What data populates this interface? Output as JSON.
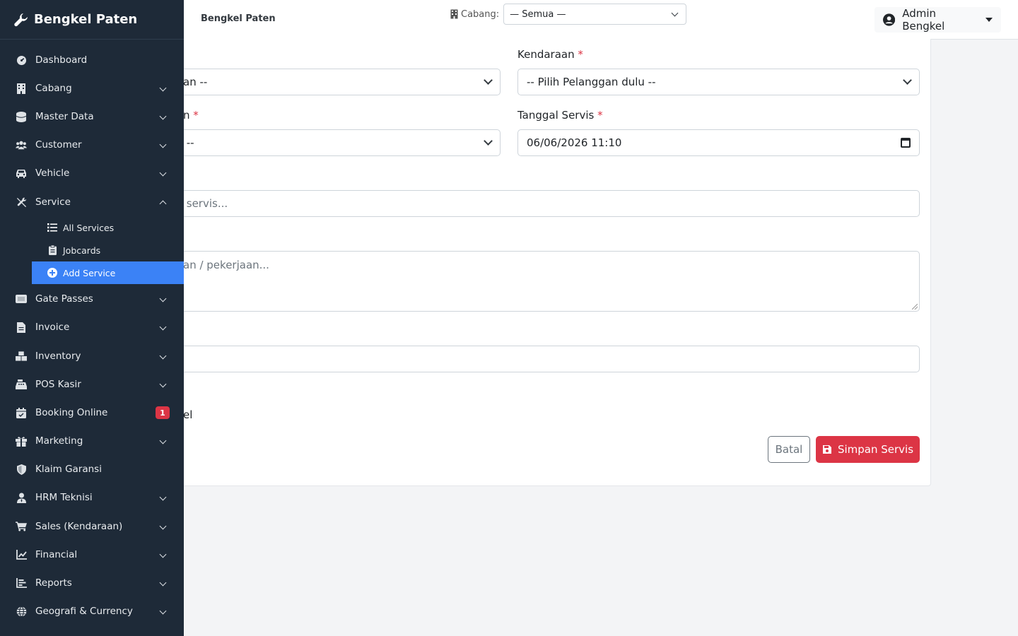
{
  "topbar": {
    "brand": "Bengkel Paten",
    "branch_label": "Cabang:",
    "branch_value": "— Semua —",
    "user_name": "Admin Bengkel"
  },
  "form": {
    "customer_select": "an --",
    "vehicle_label": "Kendaraan",
    "vehicle_select": "-- Pilih Pelanggan dulu --",
    "type_label_partial": "n",
    "type_select": " --",
    "date_label": "Tanggal Servis",
    "date_value": "06/06/2026 11:10",
    "title_placeholder": " servis...",
    "desc_placeholder": "an / pekerjaan...",
    "notes_value": "",
    "checkbox_label_partial": "el",
    "required_mark": "*",
    "cancel_label": "Batal",
    "save_label": "Simpan Servis"
  },
  "sidebar": {
    "brand": "Bengkel Paten",
    "items": [
      {
        "label": "Dashboard",
        "icon": "dashboard-icon"
      },
      {
        "label": "Cabang",
        "icon": "building-icon"
      },
      {
        "label": "Master Data",
        "icon": "database-icon"
      },
      {
        "label": "Customer",
        "icon": "users-icon"
      },
      {
        "label": "Vehicle",
        "icon": "car-icon"
      },
      {
        "label": "Service",
        "icon": "tools-icon"
      },
      {
        "label": "Gate Passes",
        "icon": "ticket-icon"
      },
      {
        "label": "Invoice",
        "icon": "file-icon"
      },
      {
        "label": "Inventory",
        "icon": "boxes-icon"
      },
      {
        "label": "POS Kasir",
        "icon": "cash-register-icon"
      },
      {
        "label": "Booking Online",
        "icon": "calendar-check-icon",
        "badge": "1"
      },
      {
        "label": "Marketing",
        "icon": "gift-icon"
      },
      {
        "label": "Klaim Garansi",
        "icon": "shield-icon"
      },
      {
        "label": "HRM Teknisi",
        "icon": "user-tie-icon"
      },
      {
        "label": "Sales (Kendaraan)",
        "icon": "cart-icon"
      },
      {
        "label": "Financial",
        "icon": "chart-line-icon"
      },
      {
        "label": "Reports",
        "icon": "chart-bar-icon"
      },
      {
        "label": "Geografi & Currency",
        "icon": "globe-icon"
      }
    ],
    "service_sub": [
      {
        "label": "All Services",
        "icon": "list-icon"
      },
      {
        "label": "Jobcards",
        "icon": "clipboard-icon"
      },
      {
        "label": "Add Service",
        "icon": "plus-circle-icon"
      }
    ]
  },
  "colors": {
    "sidebar_bg": "#1e2a38",
    "active": "#3b82f6",
    "danger": "#dc3545"
  }
}
